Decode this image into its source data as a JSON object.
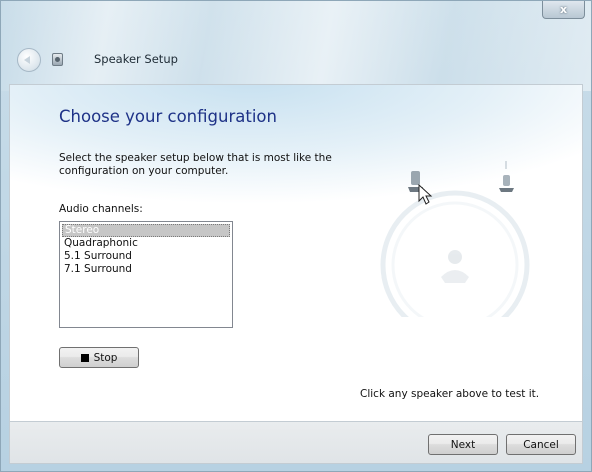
{
  "window": {
    "title": "Speaker Setup",
    "close_label": "x"
  },
  "page": {
    "heading": "Choose your configuration",
    "description": "Select the speaker setup below that is most like the configuration on your computer.",
    "channels_label": "Audio channels:",
    "channels": [
      {
        "label": "Stereo",
        "selected": true
      },
      {
        "label": "Quadraphonic",
        "selected": false
      },
      {
        "label": "5.1 Surround",
        "selected": false
      },
      {
        "label": "7.1 Surround",
        "selected": false
      }
    ],
    "stop_label": "Stop",
    "hint": "Click any speaker above to test it."
  },
  "footer": {
    "next_label": "Next",
    "cancel_label": "Cancel"
  },
  "icons": {
    "back": "back-arrow-icon",
    "app": "speaker-setup-icon",
    "stop": "stop-square-icon",
    "speaker": "speaker-icon",
    "listener": "listener-icon",
    "cursor": "mouse-cursor-icon"
  },
  "colors": {
    "heading": "#1e3287",
    "frame": "#b7d1e2",
    "selection": "#c6c6c6"
  }
}
